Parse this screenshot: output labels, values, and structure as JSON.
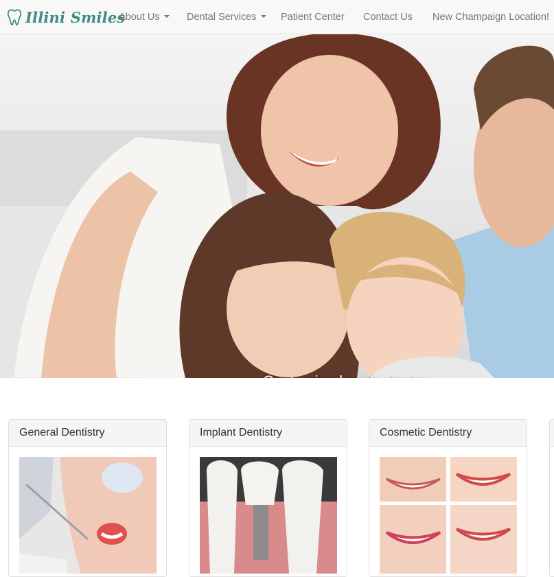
{
  "brand": {
    "name": "Illini Smiles",
    "icon": "tooth-icon",
    "color": "#3e8c83"
  },
  "nav": {
    "about": "About Us",
    "services": "Dental Services",
    "patient": "Patient Center",
    "contact": "Contact Us",
    "location": "New Champaign Location!"
  },
  "hero": {
    "caption": "Customized smile design"
  },
  "panels": [
    {
      "title": "General Dentistry"
    },
    {
      "title": "Implant Dentistry"
    },
    {
      "title": "Cosmetic Dentistry"
    }
  ]
}
